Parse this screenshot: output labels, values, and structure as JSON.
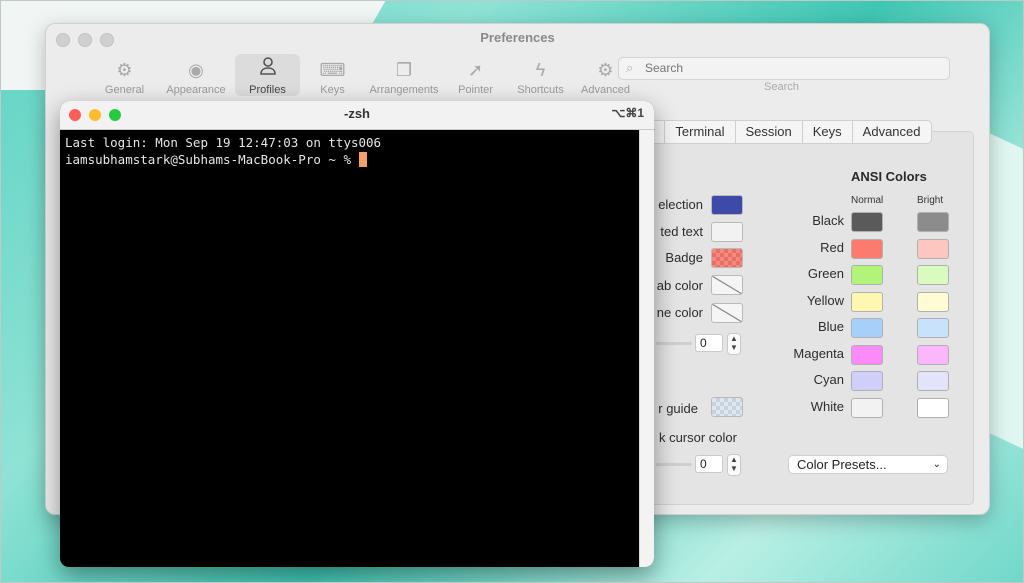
{
  "preferences": {
    "title": "Preferences",
    "toolbar": [
      {
        "label": "General",
        "icon": "gear-icon",
        "glyph": "⚙"
      },
      {
        "label": "Appearance",
        "icon": "eye-icon",
        "glyph": "◉"
      },
      {
        "label": "Profiles",
        "icon": "person-icon",
        "glyph": "👤"
      },
      {
        "label": "Keys",
        "icon": "keyboard-icon",
        "glyph": "⌨"
      },
      {
        "label": "Arrangements",
        "icon": "windows-icon",
        "glyph": "❐"
      },
      {
        "label": "Pointer",
        "icon": "pointer-icon",
        "glyph": "➚"
      },
      {
        "label": "Shortcuts",
        "icon": "bolt-icon",
        "glyph": "ϟ"
      },
      {
        "label": "Advanced",
        "icon": "gears-icon",
        "glyph": "⚙"
      }
    ],
    "search": {
      "placeholder": "Search",
      "label": "Search"
    },
    "tabs": [
      "w",
      "Terminal",
      "Session",
      "Keys",
      "Advanced"
    ],
    "color_rows": [
      {
        "label": "election",
        "swatch": "#3d4aa8"
      },
      {
        "label": "ted text",
        "swatch": "#f2f2f2"
      },
      {
        "label": "Badge",
        "swatch": "badge"
      },
      {
        "label": "ab color",
        "swatch": "none"
      },
      {
        "label": "ne color",
        "swatch": "none"
      }
    ],
    "stepper_1_value": "0",
    "stepper_2_value": "0",
    "guide_label": "r guide",
    "cursor_color_label": "k cursor color",
    "ansi": {
      "title": "ANSI Colors",
      "normal_label": "Normal",
      "bright_label": "Bright",
      "colors": [
        {
          "name": "Black",
          "normal": "#5a5a5a",
          "bright": "#8c8c8c"
        },
        {
          "name": "Red",
          "normal": "#fb7b6f",
          "bright": "#fdc6c0"
        },
        {
          "name": "Green",
          "normal": "#b2f47a",
          "bright": "#d9fbbf"
        },
        {
          "name": "Yellow",
          "normal": "#fdf7b2",
          "bright": "#fefbd5"
        },
        {
          "name": "Blue",
          "normal": "#a6cffa",
          "bright": "#c8e2fc"
        },
        {
          "name": "Magenta",
          "normal": "#fb8bf8",
          "bright": "#fcb6fa"
        },
        {
          "name": "Cyan",
          "normal": "#cfcffa",
          "bright": "#e3e3fb"
        },
        {
          "name": "White",
          "normal": "#f2f2f2",
          "bright": "#ffffff"
        }
      ]
    },
    "presets_label": "Color Presets..."
  },
  "terminal": {
    "title": "-zsh",
    "shortcut": "⌥⌘1",
    "line1": "Last login: Mon Sep 19 12:47:03 on ttys006",
    "prompt": "iamsubhamstark@Subhams-MacBook-Pro ~ % "
  }
}
